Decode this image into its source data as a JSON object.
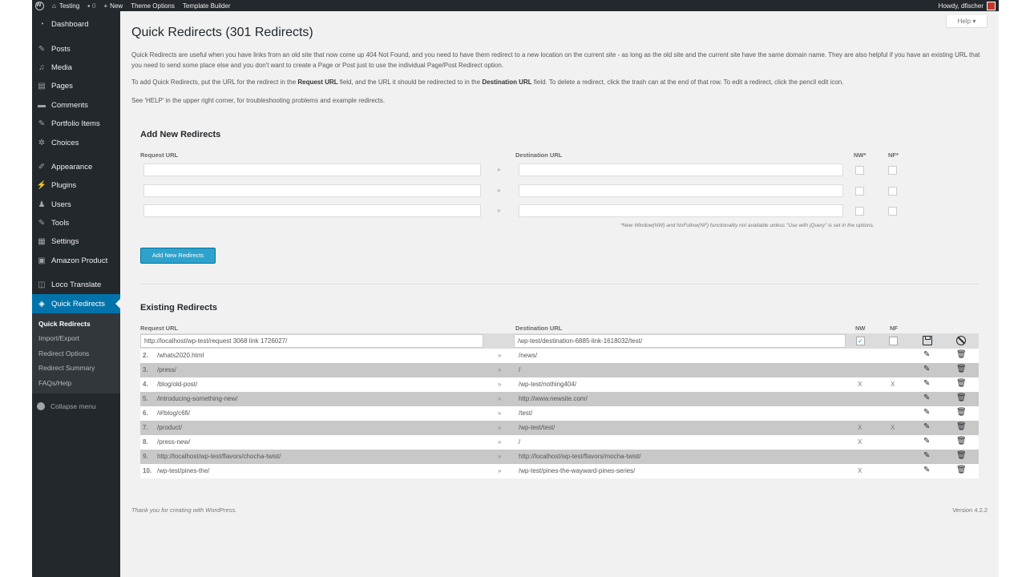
{
  "adminbar": {
    "site_name": "Testing",
    "comments_count": "0",
    "new_label": "New",
    "theme_options": "Theme Options",
    "template_builder": "Template Builder",
    "howdy": "Howdy, dfischer"
  },
  "sidebar": {
    "items": [
      {
        "label": "Dashboard",
        "icon": "dashboard-icon"
      },
      {
        "label": "Posts",
        "icon": "pin-icon"
      },
      {
        "label": "Media",
        "icon": "media-icon"
      },
      {
        "label": "Pages",
        "icon": "pages-icon"
      },
      {
        "label": "Comments",
        "icon": "comments-icon"
      },
      {
        "label": "Portfolio Items",
        "icon": "pin-icon"
      },
      {
        "label": "Choices",
        "icon": "gear-icon"
      },
      {
        "label": "Appearance",
        "icon": "brush-icon"
      },
      {
        "label": "Plugins",
        "icon": "plug-icon"
      },
      {
        "label": "Users",
        "icon": "users-icon"
      },
      {
        "label": "Tools",
        "icon": "wrench-icon"
      },
      {
        "label": "Settings",
        "icon": "settings-icon"
      },
      {
        "label": "Amazon Product",
        "icon": "amazon-icon"
      },
      {
        "label": "Loco Translate",
        "icon": "translate-icon"
      },
      {
        "label": "Quick Redirects",
        "icon": "redirect-icon"
      }
    ],
    "submenu": [
      "Quick Redirects",
      "Import/Export",
      "Redirect Options",
      "Redirect Summary",
      "FAQs/Help"
    ],
    "collapse": "Collapse menu"
  },
  "help_tab": "Help ▾",
  "page": {
    "title": "Quick Redirects (301 Redirects)",
    "intro1": "Quick Redirects are useful when you have links from an old site that now come up 404 Not Found, and you need to have them redirect to a new location on the current site - as long as the old site and the current site have the same domain name. They are also helpful if you have an existing URL that you need to send some place else and you don't want to create a Page or Post just to use the individual Page/Post Redirect option.",
    "intro2_a": "To add Quick Redirects, put the URL for the redirect in the ",
    "intro2_b": "Request URL",
    "intro2_c": " field, and the URL it should be redirected to in the ",
    "intro2_d": "Destination URL",
    "intro2_e": " field. To delete a redirect, click the trash can at the end of that row. To edit a redirect, click the pencil edit icon.",
    "intro3": "See 'HELP' in the upper right corner, for troubleshooting problems and example redirects."
  },
  "add_new": {
    "title": "Add New Redirects",
    "request_label": "Request URL",
    "dest_label": "Destination URL",
    "nw_label": "NW*",
    "nf_label": "NF*",
    "arrow": "»",
    "note": "*New Window(NW) and NoFollow(NF) functionality not available unless \"Use with jQuery\" is set in the options.",
    "button": "Add New Redirects"
  },
  "existing": {
    "title": "Existing Redirects",
    "request_label": "Request URL",
    "dest_label": "Destination URL",
    "nw_label": "NW",
    "nf_label": "NF",
    "first": {
      "request": "http://localhost/wp-test/request 3068 link 1726027/",
      "dest": "/wp-test/destination-6885-link-1618032/test/",
      "nw": "✓"
    },
    "rows": [
      {
        "num": "2.",
        "request": "/whats2020.html",
        "arrow": "»",
        "dest": "/news/",
        "nw": "",
        "nf": ""
      },
      {
        "num": "3.",
        "request": "/press/",
        "arrow": "»",
        "dest": "/",
        "nw": "",
        "nf": ""
      },
      {
        "num": "4.",
        "request": "/blog/old-post/",
        "arrow": "»",
        "dest": "/wp-test/nothing404/",
        "nw": "X",
        "nf": "X"
      },
      {
        "num": "5.",
        "request": "/introducing-something-new/",
        "arrow": "»",
        "dest": "http://www.newsite.com/",
        "nw": "",
        "nf": ""
      },
      {
        "num": "6.",
        "request": "/#!blog/c6fi/",
        "arrow": "»",
        "dest": "/test/",
        "nw": "",
        "nf": ""
      },
      {
        "num": "7.",
        "request": "/product/",
        "arrow": "»",
        "dest": "/wp-test/test/",
        "nw": "X",
        "nf": "X"
      },
      {
        "num": "8.",
        "request": "/press-new/",
        "arrow": "»",
        "dest": "/",
        "nw": "X",
        "nf": ""
      },
      {
        "num": "9.",
        "request": "http://localhost/wp-test/flavors/chocha-twist/",
        "arrow": "»",
        "dest": "http://localhost/wp-test/flavors/mocha-twist/",
        "nw": "",
        "nf": ""
      },
      {
        "num": "10.",
        "request": "/wp-test/pines-the/",
        "arrow": "»",
        "dest": "/wp-test/pines-the-wayward-pines-series/",
        "nw": "X",
        "nf": ""
      }
    ]
  },
  "footer": {
    "left": "Thank you for creating with WordPress.",
    "right": "Version 4.2.2"
  }
}
